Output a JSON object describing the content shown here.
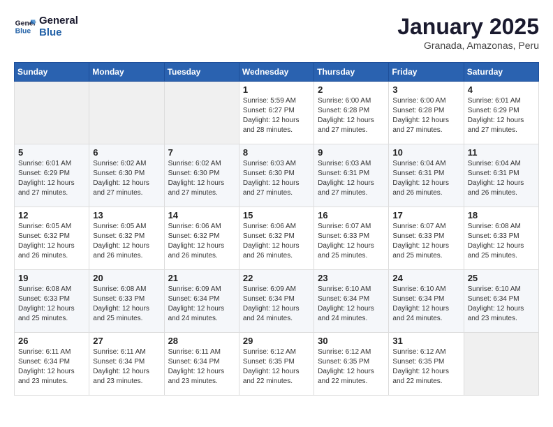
{
  "logo": {
    "line1": "General",
    "line2": "Blue"
  },
  "title": "January 2025",
  "subtitle": "Granada, Amazonas, Peru",
  "days_header": [
    "Sunday",
    "Monday",
    "Tuesday",
    "Wednesday",
    "Thursday",
    "Friday",
    "Saturday"
  ],
  "weeks": [
    [
      {
        "day": "",
        "sunrise": "",
        "sunset": "",
        "daylight": ""
      },
      {
        "day": "",
        "sunrise": "",
        "sunset": "",
        "daylight": ""
      },
      {
        "day": "",
        "sunrise": "",
        "sunset": "",
        "daylight": ""
      },
      {
        "day": "1",
        "sunrise": "Sunrise: 5:59 AM",
        "sunset": "Sunset: 6:27 PM",
        "daylight": "Daylight: 12 hours and 28 minutes."
      },
      {
        "day": "2",
        "sunrise": "Sunrise: 6:00 AM",
        "sunset": "Sunset: 6:28 PM",
        "daylight": "Daylight: 12 hours and 27 minutes."
      },
      {
        "day": "3",
        "sunrise": "Sunrise: 6:00 AM",
        "sunset": "Sunset: 6:28 PM",
        "daylight": "Daylight: 12 hours and 27 minutes."
      },
      {
        "day": "4",
        "sunrise": "Sunrise: 6:01 AM",
        "sunset": "Sunset: 6:29 PM",
        "daylight": "Daylight: 12 hours and 27 minutes."
      }
    ],
    [
      {
        "day": "5",
        "sunrise": "Sunrise: 6:01 AM",
        "sunset": "Sunset: 6:29 PM",
        "daylight": "Daylight: 12 hours and 27 minutes."
      },
      {
        "day": "6",
        "sunrise": "Sunrise: 6:02 AM",
        "sunset": "Sunset: 6:30 PM",
        "daylight": "Daylight: 12 hours and 27 minutes."
      },
      {
        "day": "7",
        "sunrise": "Sunrise: 6:02 AM",
        "sunset": "Sunset: 6:30 PM",
        "daylight": "Daylight: 12 hours and 27 minutes."
      },
      {
        "day": "8",
        "sunrise": "Sunrise: 6:03 AM",
        "sunset": "Sunset: 6:30 PM",
        "daylight": "Daylight: 12 hours and 27 minutes."
      },
      {
        "day": "9",
        "sunrise": "Sunrise: 6:03 AM",
        "sunset": "Sunset: 6:31 PM",
        "daylight": "Daylight: 12 hours and 27 minutes."
      },
      {
        "day": "10",
        "sunrise": "Sunrise: 6:04 AM",
        "sunset": "Sunset: 6:31 PM",
        "daylight": "Daylight: 12 hours and 26 minutes."
      },
      {
        "day": "11",
        "sunrise": "Sunrise: 6:04 AM",
        "sunset": "Sunset: 6:31 PM",
        "daylight": "Daylight: 12 hours and 26 minutes."
      }
    ],
    [
      {
        "day": "12",
        "sunrise": "Sunrise: 6:05 AM",
        "sunset": "Sunset: 6:32 PM",
        "daylight": "Daylight: 12 hours and 26 minutes."
      },
      {
        "day": "13",
        "sunrise": "Sunrise: 6:05 AM",
        "sunset": "Sunset: 6:32 PM",
        "daylight": "Daylight: 12 hours and 26 minutes."
      },
      {
        "day": "14",
        "sunrise": "Sunrise: 6:06 AM",
        "sunset": "Sunset: 6:32 PM",
        "daylight": "Daylight: 12 hours and 26 minutes."
      },
      {
        "day": "15",
        "sunrise": "Sunrise: 6:06 AM",
        "sunset": "Sunset: 6:32 PM",
        "daylight": "Daylight: 12 hours and 26 minutes."
      },
      {
        "day": "16",
        "sunrise": "Sunrise: 6:07 AM",
        "sunset": "Sunset: 6:33 PM",
        "daylight": "Daylight: 12 hours and 25 minutes."
      },
      {
        "day": "17",
        "sunrise": "Sunrise: 6:07 AM",
        "sunset": "Sunset: 6:33 PM",
        "daylight": "Daylight: 12 hours and 25 minutes."
      },
      {
        "day": "18",
        "sunrise": "Sunrise: 6:08 AM",
        "sunset": "Sunset: 6:33 PM",
        "daylight": "Daylight: 12 hours and 25 minutes."
      }
    ],
    [
      {
        "day": "19",
        "sunrise": "Sunrise: 6:08 AM",
        "sunset": "Sunset: 6:33 PM",
        "daylight": "Daylight: 12 hours and 25 minutes."
      },
      {
        "day": "20",
        "sunrise": "Sunrise: 6:08 AM",
        "sunset": "Sunset: 6:33 PM",
        "daylight": "Daylight: 12 hours and 25 minutes."
      },
      {
        "day": "21",
        "sunrise": "Sunrise: 6:09 AM",
        "sunset": "Sunset: 6:34 PM",
        "daylight": "Daylight: 12 hours and 24 minutes."
      },
      {
        "day": "22",
        "sunrise": "Sunrise: 6:09 AM",
        "sunset": "Sunset: 6:34 PM",
        "daylight": "Daylight: 12 hours and 24 minutes."
      },
      {
        "day": "23",
        "sunrise": "Sunrise: 6:10 AM",
        "sunset": "Sunset: 6:34 PM",
        "daylight": "Daylight: 12 hours and 24 minutes."
      },
      {
        "day": "24",
        "sunrise": "Sunrise: 6:10 AM",
        "sunset": "Sunset: 6:34 PM",
        "daylight": "Daylight: 12 hours and 24 minutes."
      },
      {
        "day": "25",
        "sunrise": "Sunrise: 6:10 AM",
        "sunset": "Sunset: 6:34 PM",
        "daylight": "Daylight: 12 hours and 23 minutes."
      }
    ],
    [
      {
        "day": "26",
        "sunrise": "Sunrise: 6:11 AM",
        "sunset": "Sunset: 6:34 PM",
        "daylight": "Daylight: 12 hours and 23 minutes."
      },
      {
        "day": "27",
        "sunrise": "Sunrise: 6:11 AM",
        "sunset": "Sunset: 6:34 PM",
        "daylight": "Daylight: 12 hours and 23 minutes."
      },
      {
        "day": "28",
        "sunrise": "Sunrise: 6:11 AM",
        "sunset": "Sunset: 6:34 PM",
        "daylight": "Daylight: 12 hours and 23 minutes."
      },
      {
        "day": "29",
        "sunrise": "Sunrise: 6:12 AM",
        "sunset": "Sunset: 6:35 PM",
        "daylight": "Daylight: 12 hours and 22 minutes."
      },
      {
        "day": "30",
        "sunrise": "Sunrise: 6:12 AM",
        "sunset": "Sunset: 6:35 PM",
        "daylight": "Daylight: 12 hours and 22 minutes."
      },
      {
        "day": "31",
        "sunrise": "Sunrise: 6:12 AM",
        "sunset": "Sunset: 6:35 PM",
        "daylight": "Daylight: 12 hours and 22 minutes."
      },
      {
        "day": "",
        "sunrise": "",
        "sunset": "",
        "daylight": ""
      }
    ]
  ]
}
